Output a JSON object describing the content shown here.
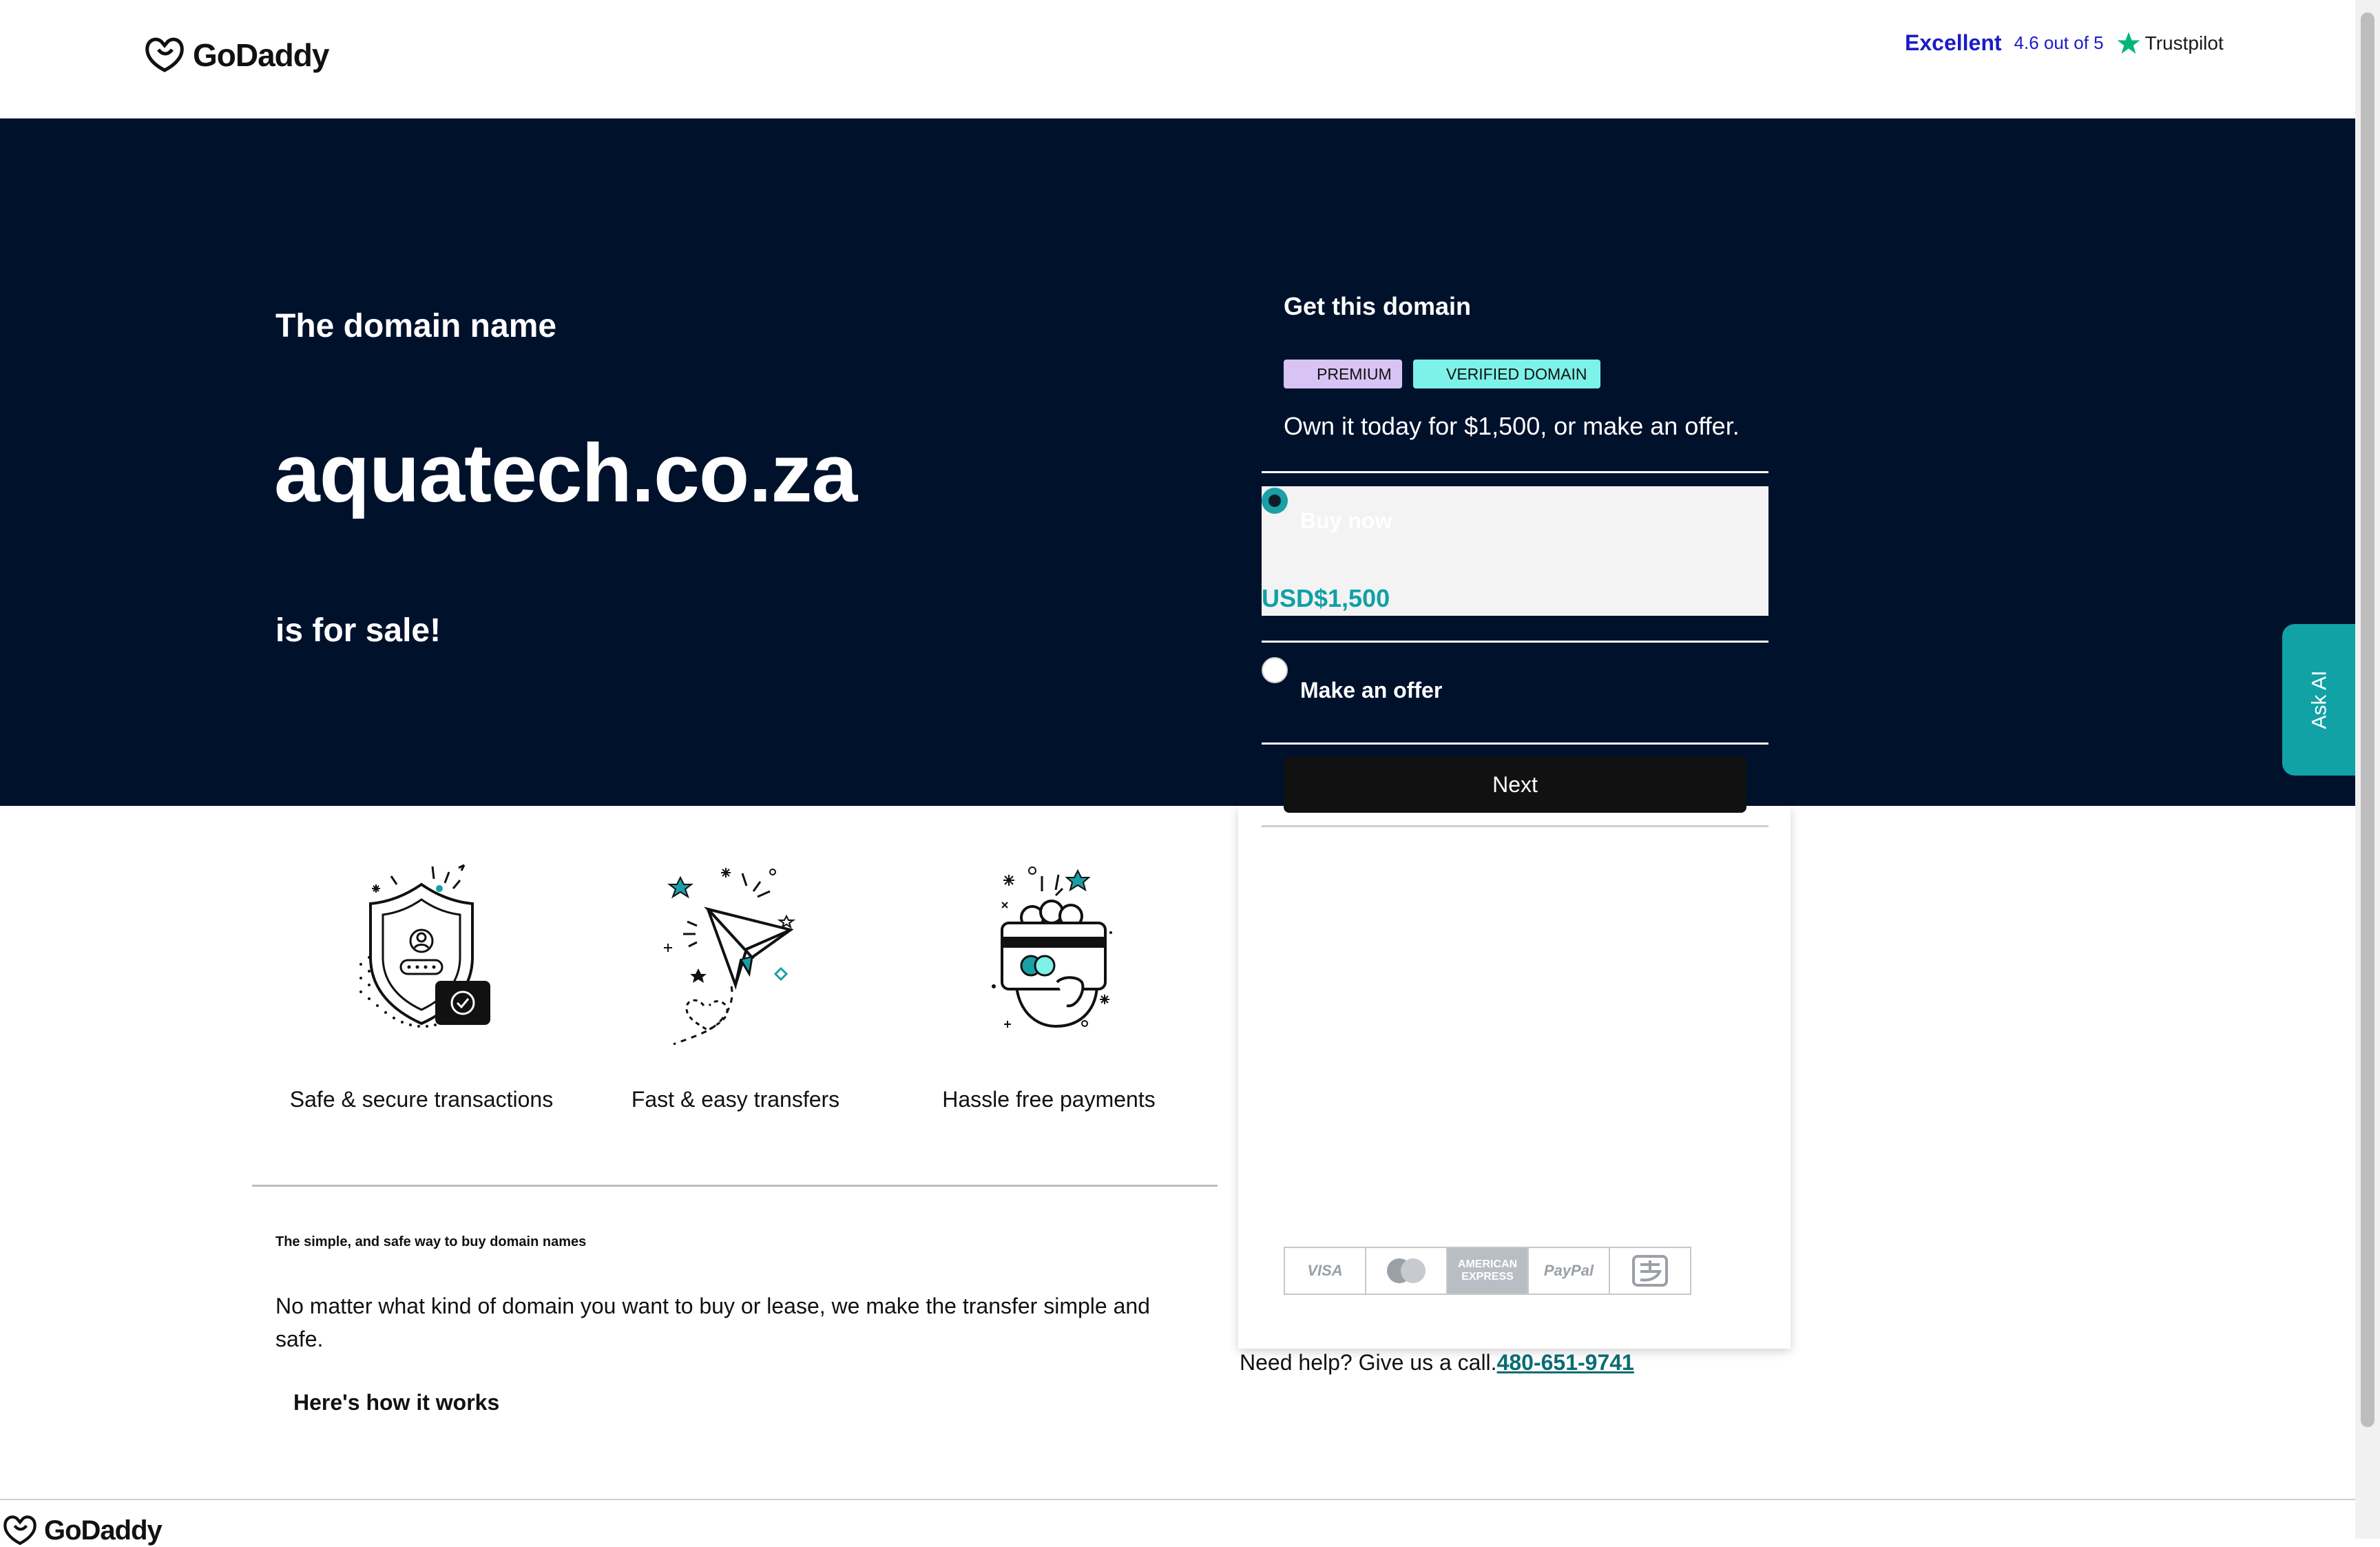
{
  "header": {
    "brand": "GoDaddy",
    "trustpilot": {
      "rating_label": "Excellent",
      "score_text": "4.6 out of 5",
      "brand": "Trustpilot"
    }
  },
  "hero": {
    "pre_text": "The domain name",
    "domain": "aquatech.co.za",
    "post_text": "is for sale!"
  },
  "panel": {
    "title": "Get this domain",
    "badges": [
      "PREMIUM",
      "VERIFIED DOMAIN"
    ],
    "description": "Own it today for $1,500, or make an offer.",
    "options": {
      "buy_now": {
        "label": "Buy now",
        "price": "USD$1,500",
        "selected": true
      },
      "make_offer": {
        "label": "Make an offer",
        "selected": false
      }
    },
    "next_label": "Next",
    "payments": [
      "VISA",
      "Mastercard",
      "AMERICAN EXPRESS",
      "PayPal",
      "Alipay"
    ]
  },
  "help": {
    "text": "Need help? Give us a call.",
    "phone": "480-651-9741"
  },
  "ask_ai": "Ask AI",
  "features": [
    {
      "label": "Safe & secure transactions",
      "icon": "shield-icon"
    },
    {
      "label": "Fast & easy transfers",
      "icon": "paper-plane-icon"
    },
    {
      "label": "Hassle free payments",
      "icon": "payment-card-icon"
    }
  ],
  "about": {
    "title": "The simple, and safe way to buy domain names",
    "text": "No matter what kind of domain you want to buy or lease, we make the transfer simple and safe.",
    "link": "Here's how it works"
  },
  "footer": {
    "brand": "GoDaddy"
  },
  "colors": {
    "hero_bg": "#00112c",
    "accent_teal": "#10a0a6",
    "premium_badge": "#d7c4f5",
    "verified_badge": "#7cf2e9",
    "trustpilot_blue": "#1b1bc8",
    "trustpilot_star": "#00b67a"
  }
}
